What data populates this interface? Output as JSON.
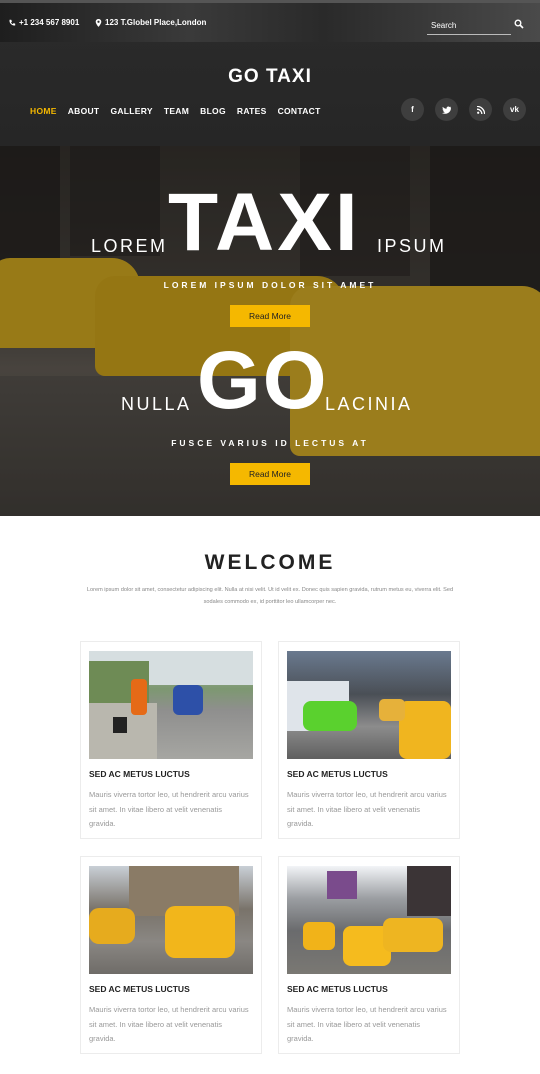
{
  "topbar": {
    "phone": "+1 234 567 8901",
    "address": "123 T.Globel Place,London",
    "search_placeholder": "Search"
  },
  "brand": "GO TAXI",
  "nav": [
    "HOME",
    "ABOUT",
    "GALLERY",
    "TEAM",
    "BLOG",
    "RATES",
    "CONTACT"
  ],
  "nav_active": "HOME",
  "social": [
    "facebook-icon",
    "twitter-icon",
    "rss-icon",
    "vk-icon"
  ],
  "hero": {
    "slide1": {
      "left": "LOREM",
      "big": "TAXI",
      "right": "IPSUM",
      "sub": "LOREM IPSUM DOLOR SIT AMET",
      "button": "Read More"
    },
    "slide2": {
      "left": "NULLA",
      "big": "GO",
      "right": "LACINIA",
      "sub": "FUSCE VARIUS ID LECTUS AT",
      "button": "Read More"
    }
  },
  "welcome": {
    "title": "WELCOME",
    "text": "Lorem ipsum dolor sit amet, consectetur adipiscing elit. Nulla at nisi velit. Ut id velit ex. Donec quis sapien gravida, rutrum metus eu, viverra elit. Sed sodales commodo ex, id porttitor leo ullamcorper nec."
  },
  "cards": [
    {
      "title": "SED AC METUS LUCTUS",
      "text": "Mauris viverra tortor leo, ut hendrerit arcu varius sit amet. In vitae libero at velit venenatis gravida."
    },
    {
      "title": "SED AC METUS LUCTUS",
      "text": "Mauris viverra tortor leo, ut hendrerit arcu varius sit amet. In vitae libero at velit venenatis gravida."
    },
    {
      "title": "SED AC METUS LUCTUS",
      "text": "Mauris viverra tortor leo, ut hendrerit arcu varius sit amet. In vitae libero at velit venenatis gravida."
    },
    {
      "title": "SED AC METUS LUCTUS",
      "text": "Mauris viverra tortor leo, ut hendrerit arcu varius sit amet. In vitae libero at velit venenatis gravida."
    }
  ],
  "colors": {
    "accent": "#f5b800",
    "dark": "#262626"
  }
}
